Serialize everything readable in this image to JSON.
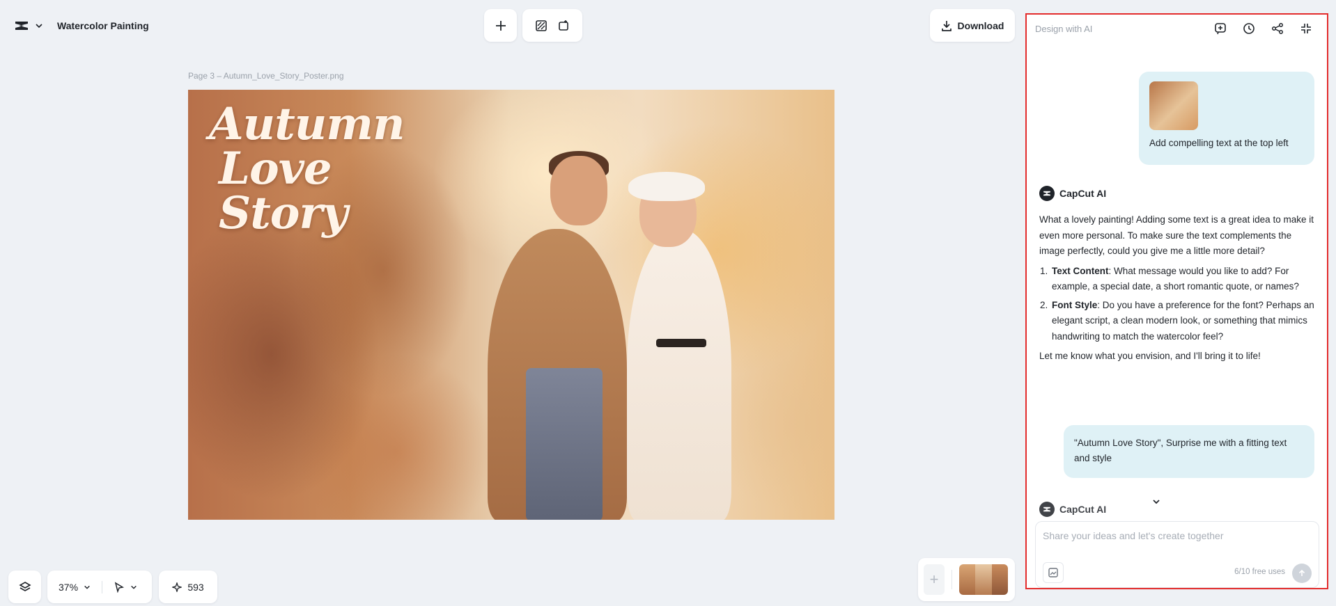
{
  "app": {
    "title": "Watercolor Painting"
  },
  "toolbar": {
    "download_label": "Download"
  },
  "canvas": {
    "page_label": "Page 3 –  Autumn_Love_Story_Poster.png",
    "poster_title_line1": "Autumn",
    "poster_title_line2": "Love Story"
  },
  "panel": {
    "title": "Design with AI",
    "header_icons": [
      "new-chat-icon",
      "history-icon",
      "share-icon",
      "collapse-icon"
    ],
    "messages": {
      "user1": "Add compelling text at the top left",
      "ai_name": "CapCut AI",
      "ai_intro": "What a lovely painting! Adding some text is a great idea to make it even more personal. To make sure the text complements the image perfectly, could you give me a little more detail?",
      "ai_item1_title": "Text Content",
      "ai_item1_text": ": What message would you like to add? For example, a special date, a short romantic quote, or names?",
      "ai_item2_title": "Font Style",
      "ai_item2_text": ": Do you have a preference for the font? Perhaps an elegant script, a clean modern look, or something that mimics handwriting to match the watercolor feel?",
      "ai_outro": "Let me know what you envision, and I'll bring it to life!",
      "user2": "\"Autumn Love Story\", Surprise me with a fitting text and style",
      "ai_name2": "CapCut AI"
    },
    "input": {
      "placeholder": "Share your ideas and let's create together",
      "value": "",
      "free_uses": "6/10 free uses"
    }
  },
  "bottom": {
    "zoom": "37%",
    "credits": "593"
  },
  "colors": {
    "highlight_border": "#e32b2b",
    "user_bubble": "#dff1f6",
    "background": "#eef1f5"
  }
}
